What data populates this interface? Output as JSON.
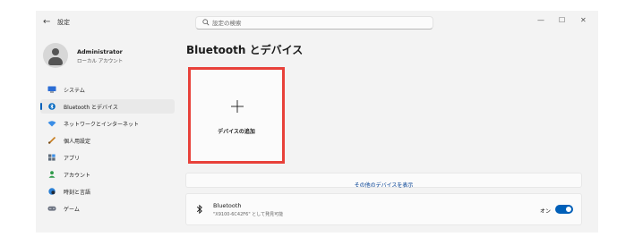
{
  "window": {
    "title": "設定",
    "back_glyph": "←",
    "controls": {
      "minimize": "—",
      "maximize": "☐",
      "close": "✕"
    }
  },
  "search": {
    "placeholder": "設定の検索"
  },
  "profile": {
    "name": "Administrator",
    "account_type": "ローカル アカウント"
  },
  "sidebar": {
    "items": [
      {
        "label": "システム",
        "icon": "monitor-icon",
        "color": "#2b6cd4"
      },
      {
        "label": "Bluetooth とデバイス",
        "icon": "bluetooth-icon",
        "color": "#0067c0",
        "active": true
      },
      {
        "label": "ネットワークとインターネット",
        "icon": "wifi-icon",
        "color": "#3a8ee6"
      },
      {
        "label": "個人用設定",
        "icon": "brush-icon",
        "color": "#c77d1e"
      },
      {
        "label": "アプリ",
        "icon": "apps-icon",
        "color": "#5d6b7a"
      },
      {
        "label": "アカウント",
        "icon": "person-icon",
        "color": "#2f9a4a"
      },
      {
        "label": "時刻と言語",
        "icon": "globe-clock-icon",
        "color": "#2a7fd4"
      },
      {
        "label": "ゲーム",
        "icon": "gamepad-icon",
        "color": "#6b7280"
      }
    ]
  },
  "main": {
    "title": "Bluetooth とデバイス",
    "add_device": {
      "label": "デバイスの追加"
    },
    "show_more": {
      "label": "その他のデバイスを表示"
    },
    "bluetooth": {
      "title": "Bluetooth",
      "subtitle": "\"X9100-6C42F6\" として発見可能",
      "state": "オン",
      "on": true
    }
  },
  "colors": {
    "accent": "#005fb8",
    "highlight": "#e8413a"
  }
}
